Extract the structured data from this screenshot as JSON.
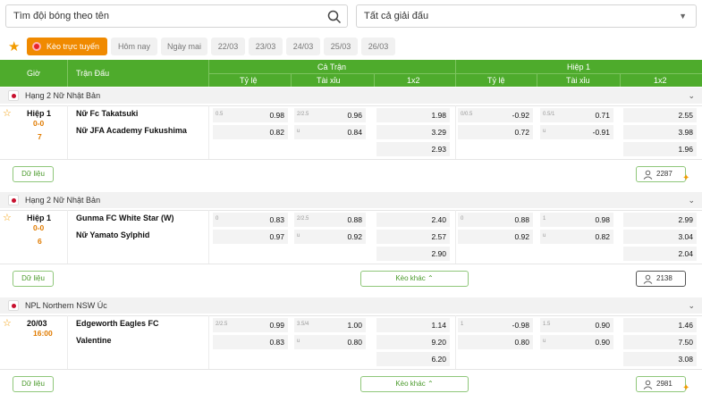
{
  "search": {
    "placeholder": "Tìm đội bóng theo tên"
  },
  "tournament_select": {
    "value": "Tất cả giải đấu"
  },
  "date_tabs": {
    "live": "Kèo trực tuyến",
    "items": [
      "Hôm nay",
      "Ngày mai",
      "22/03",
      "23/03",
      "24/03",
      "25/03",
      "26/03"
    ]
  },
  "header": {
    "time": "Giờ",
    "match": "Trận Đấu",
    "full_time": "Cả Trận",
    "first_half": "Hiệp 1",
    "handicap": "Tỷ lệ",
    "over_under": "Tài xỉu",
    "one_x_two": "1x2"
  },
  "leagues": [
    {
      "name": "Hạng 2 Nữ Nhật Bản",
      "status": "Hiệp 1",
      "score": "0-0",
      "minute": "7",
      "home": "Nữ Fc Takatsuki",
      "away": "Nữ JFA Academy Fukushima",
      "ft_hdp": {
        "line": "0.5",
        "home": "0.98",
        "away": "0.82"
      },
      "ft_ou": {
        "line": "2/2.5",
        "over": "0.96",
        "under_label": "u",
        "under": "0.84"
      },
      "ft_1x2": [
        "1.98",
        "3.29",
        "2.93"
      ],
      "h1_hdp": {
        "line": "0/0.5",
        "home": "-0.92",
        "away": "0.72"
      },
      "h1_ou": {
        "line": "0.5/1",
        "over": "0.71",
        "under_label": "u",
        "under": "-0.91"
      },
      "h1_1x2": [
        "2.55",
        "3.98",
        "1.96"
      ],
      "data_label": "Dữ liệu",
      "more_label": "",
      "count": "2287"
    },
    {
      "name": "Hạng 2 Nữ Nhật Bản",
      "status": "Hiệp 1",
      "score": "0-0",
      "minute": "6",
      "home": "Gunma FC White Star (W)",
      "away": "Nữ Yamato Sylphid",
      "ft_hdp": {
        "line": "0",
        "home": "0.83",
        "away": "0.97"
      },
      "ft_ou": {
        "line": "2/2.5",
        "over": "0.88",
        "under_label": "u",
        "under": "0.92"
      },
      "ft_1x2": [
        "2.40",
        "2.57",
        "2.90"
      ],
      "h1_hdp": {
        "line": "0",
        "home": "0.88",
        "away": "0.92"
      },
      "h1_ou": {
        "line": "1",
        "over": "0.98",
        "under_label": "u",
        "under": "0.82"
      },
      "h1_1x2": [
        "2.99",
        "3.04",
        "2.04"
      ],
      "data_label": "Dữ liệu",
      "more_label": "Kèo khác",
      "count": "2138"
    },
    {
      "name": "NPL Northern NSW Úc",
      "status": "20/03",
      "score": "16:00",
      "minute": "",
      "home": "Edgeworth Eagles FC",
      "away": "Valentine",
      "ft_hdp": {
        "line": "2/2.5",
        "home": "0.99",
        "away": "0.83"
      },
      "ft_ou": {
        "line": "3.5/4",
        "over": "1.00",
        "under_label": "u",
        "under": "0.80"
      },
      "ft_1x2": [
        "1.14",
        "9.20",
        "6.20"
      ],
      "h1_hdp": {
        "line": "1",
        "home": "-0.98",
        "away": "0.80"
      },
      "h1_ou": {
        "line": "1.5",
        "over": "0.90",
        "under_label": "u",
        "under": "0.90"
      },
      "h1_1x2": [
        "1.46",
        "7.50",
        "3.08"
      ],
      "data_label": "Dữ liệu",
      "more_label": "Kèo khác",
      "count": "2981"
    }
  ],
  "colors": {
    "accent": "#4eab2c",
    "orange": "#f08a00",
    "star": "#f29b00"
  }
}
